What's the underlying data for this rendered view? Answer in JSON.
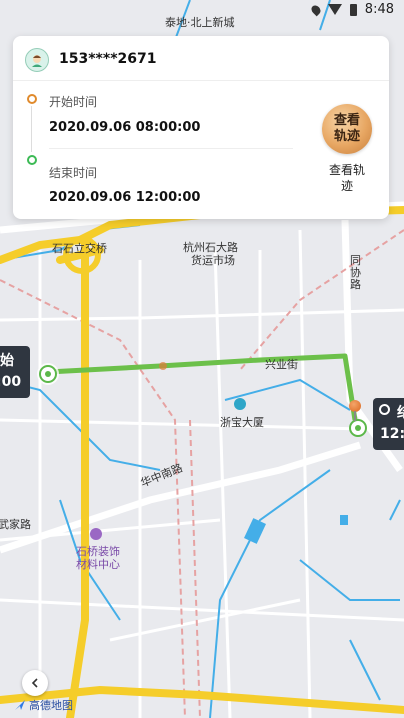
{
  "status_bar": {
    "time": "8:48"
  },
  "user": {
    "phone": "153****2671"
  },
  "start": {
    "label": "开始时间",
    "value": "2020.09.06 08:00:00"
  },
  "end": {
    "label": "结束时间",
    "value": "2020.09.06 12:00:00"
  },
  "track_button": {
    "line1": "查看",
    "line2": "轨迹",
    "caption_line1": "查看轨",
    "caption_line2": "迹"
  },
  "map_labels": {
    "top_place": "泰地·北上新城",
    "interchange": "石石立交桥",
    "market_line1": "杭州石大路",
    "market_line2": "货运市场",
    "xingye": "兴业街",
    "zhebao": "浙宝大厦",
    "huazhong": "华中南路",
    "shiqiao_line1": "石桥装饰",
    "shiqiao_line2": "材料中心",
    "wu_road": "武家路",
    "tongxie": "同协路",
    "logo": "高德地图"
  },
  "bubbles": {
    "left_top": "始",
    "left_bottom": ":00",
    "right_top": "结",
    "right_bottom": "12:"
  },
  "colors": {
    "route": "#6cc04a",
    "road_major": "#f5cd2a",
    "water": "#44aee8",
    "bubble": "#2f3640"
  }
}
